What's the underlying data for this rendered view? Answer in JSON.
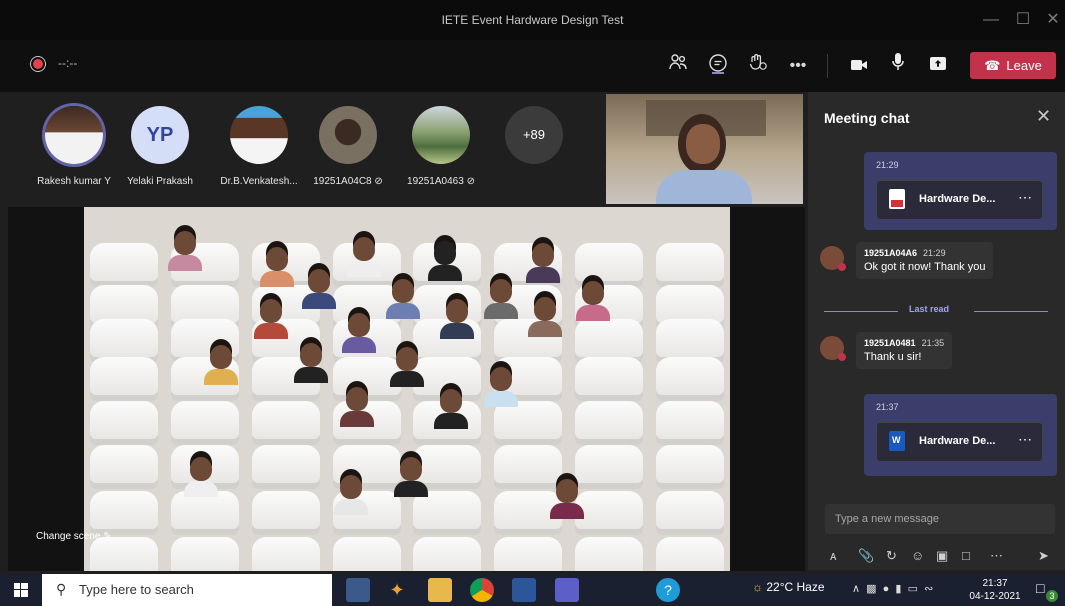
{
  "window": {
    "title": "IETE Event Hardware Design Test"
  },
  "toolbar": {
    "record_time": "--:--",
    "leave_label": "Leave"
  },
  "participants": [
    {
      "name": "Rakesh kumar Y"
    },
    {
      "name": "Yelaki Prakash",
      "initials": "YP"
    },
    {
      "name": "Dr.B.Venkatesh..."
    },
    {
      "name": "19251A04C8"
    },
    {
      "name": "19251A0463"
    },
    {
      "name": "+89"
    }
  ],
  "stage": {
    "change_scene": "Change scene"
  },
  "chat": {
    "title": "Meeting chat",
    "items": [
      {
        "type": "file",
        "time": "21:29",
        "file": "Hardware De..."
      },
      {
        "type": "message",
        "author": "19251A04A6",
        "time": "21:29",
        "text": "Ok got it now! Thank you"
      },
      {
        "type": "divider",
        "label": "Last read"
      },
      {
        "type": "message",
        "author": "19251A0481",
        "time": "21:35",
        "text": "Thank u sir!"
      },
      {
        "type": "file",
        "time": "21:37",
        "file": "Hardware De..."
      }
    ],
    "composer_placeholder": "Type a new message"
  },
  "taskbar": {
    "search_placeholder": "Type here to search",
    "weather": "22°C  Haze",
    "time": "21:37",
    "date": "04-12-2021",
    "notification_count": "3"
  }
}
